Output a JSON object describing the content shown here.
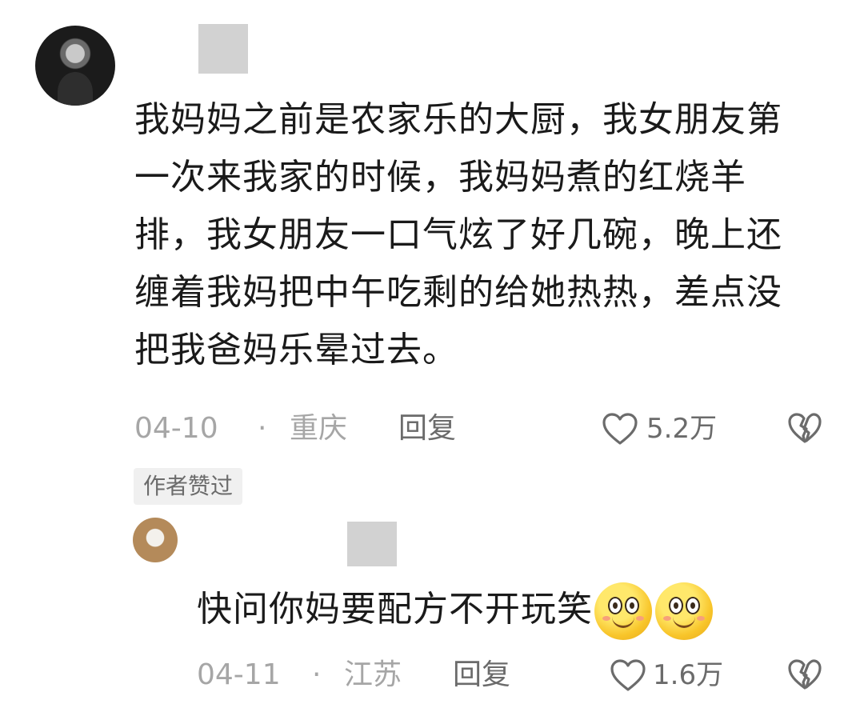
{
  "comment": {
    "text": "我妈妈之前是农家乐的大厨，我女朋友第一次来我家的时候，我妈妈煮的红烧羊排，我女朋友一口气炫了好几碗，晚上还缠着我妈把中午吃剩的给她热热，差点没把我爸妈乐晕过去。",
    "date": "04-10",
    "separator": "·",
    "location": "重庆",
    "reply_label": "回复",
    "likes": "5.2万",
    "badge": "作者赞过",
    "avatar_icon": "user-avatar",
    "like_icon": "heart-outline-icon",
    "dislike_icon": "broken-heart-icon"
  },
  "reply_comment": {
    "text": "快问你妈要配方不开玩笑",
    "emojis": [
      "smiley-face-emoji",
      "smiley-face-emoji"
    ],
    "date": "04-11",
    "separator": "·",
    "location": "江苏",
    "reply_label": "回复",
    "likes": "1.6万"
  },
  "colors": {
    "meta_gray": "#a6a6a6",
    "action_gray": "#6b6b6b",
    "badge_bg": "#f0f0f0",
    "mask_gray": "#d2d2d2"
  }
}
